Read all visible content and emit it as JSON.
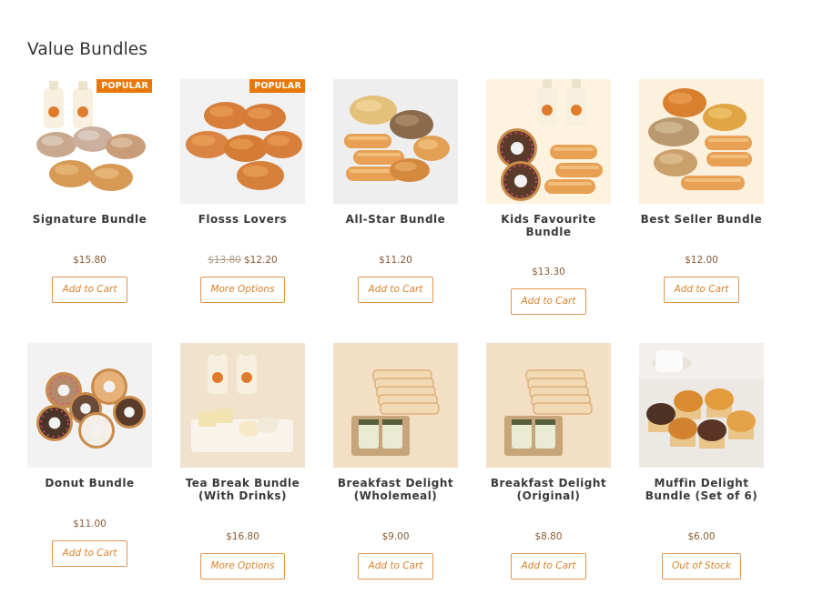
{
  "section": {
    "title": "Value Bundles"
  },
  "products": [
    {
      "name": "Signature Bundle",
      "badge": "POPULAR",
      "old_price": "",
      "price": "$15.80",
      "action": "Add to Cart",
      "image": "milk-bottles-floss-buns",
      "bg": "#ffffff"
    },
    {
      "name": "Flosss Lovers",
      "badge": "POPULAR",
      "old_price": "$13.80",
      "price": "$12.20",
      "action": "More Options",
      "image": "floss-buns",
      "bg": "#f1f1f1"
    },
    {
      "name": "All-Star Bundle",
      "badge": "",
      "old_price": "",
      "price": "$11.20",
      "action": "Add to Cart",
      "image": "assorted-breads",
      "bg": "#eeeeee"
    },
    {
      "name": "Kids Favourite Bundle",
      "badge": "",
      "old_price": "",
      "price": "$13.30",
      "action": "Add to Cart",
      "image": "milk-donuts-sausage-rolls",
      "bg": "#fdf3df"
    },
    {
      "name": "Best Seller Bundle",
      "badge": "",
      "old_price": "",
      "price": "$12.00",
      "action": "Add to Cart",
      "image": "best-seller-breads",
      "bg": "#fbf1dc"
    },
    {
      "name": "Donut Bundle",
      "badge": "",
      "old_price": "",
      "price": "$11.00",
      "action": "Add to Cart",
      "image": "donuts",
      "bg": "#f2f2f2"
    },
    {
      "name": "Tea Break Bundle (With Drinks)",
      "badge": "",
      "old_price": "",
      "price": "$16.80",
      "action": "More Options",
      "image": "tea-break-drinks",
      "bg": "#f0e2cc"
    },
    {
      "name": "Breakfast Delight (Wholemeal)",
      "badge": "",
      "old_price": "",
      "price": "$9.00",
      "action": "Add to Cart",
      "image": "bread-and-jars",
      "bg": "#f3dfc4"
    },
    {
      "name": "Breakfast Delight (Original)",
      "badge": "",
      "old_price": "",
      "price": "$8.80",
      "action": "Add to Cart",
      "image": "bread-and-jars",
      "bg": "#f3dfc4"
    },
    {
      "name": "Muffin Delight Bundle (Set of 6)",
      "badge": "",
      "old_price": "",
      "price": "$6.00",
      "action": "Out of Stock",
      "image": "muffins-tea",
      "bg": "#ece8e4"
    }
  ]
}
